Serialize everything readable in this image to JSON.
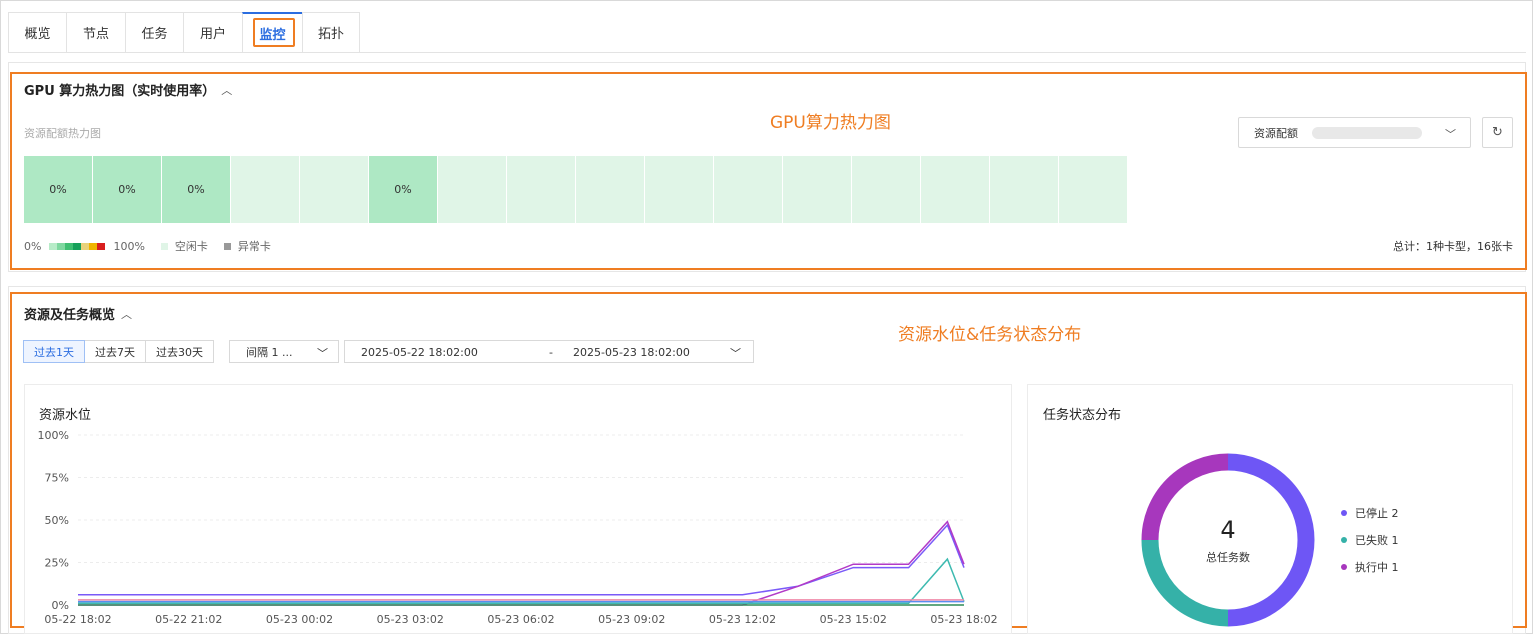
{
  "tabs": [
    {
      "label": "概览"
    },
    {
      "label": "节点"
    },
    {
      "label": "任务"
    },
    {
      "label": "用户"
    },
    {
      "label": "监控",
      "active": true
    },
    {
      "label": "拓扑"
    }
  ],
  "gpu_panel": {
    "title": "GPU 算力热力图（实时使用率）",
    "annotation": "GPU算力热力图",
    "subtitle": "资源配额热力图",
    "select_label": "资源配额",
    "cells": [
      {
        "state": "used",
        "label": "0%"
      },
      {
        "state": "used",
        "label": "0%"
      },
      {
        "state": "used",
        "label": "0%"
      },
      {
        "state": "idle",
        "label": ""
      },
      {
        "state": "idle",
        "label": ""
      },
      {
        "state": "used",
        "label": "0%"
      },
      {
        "state": "idle",
        "label": ""
      },
      {
        "state": "idle",
        "label": ""
      },
      {
        "state": "idle",
        "label": ""
      },
      {
        "state": "idle",
        "label": ""
      },
      {
        "state": "idle",
        "label": ""
      },
      {
        "state": "idle",
        "label": ""
      },
      {
        "state": "idle",
        "label": ""
      },
      {
        "state": "idle",
        "label": ""
      },
      {
        "state": "idle",
        "label": ""
      },
      {
        "state": "idle",
        "label": ""
      }
    ],
    "legend": {
      "min": "0%",
      "max": "100%",
      "idle": "空闲卡",
      "abnormal": "异常卡",
      "gradient_colors": [
        "#b7ecc8",
        "#7fd8a0",
        "#3fbf72",
        "#16a05a",
        "#e9d27a",
        "#f0b400",
        "#d91e1e"
      ],
      "idle_color": "#e0f5e7",
      "abnormal_color": "#999999"
    },
    "total": "总计：1种卡型，16张卡"
  },
  "overview_panel": {
    "title": "资源及任务概览",
    "annotation": "资源水位&任务状态分布",
    "range_buttons": [
      {
        "label": "过去1天",
        "active": true
      },
      {
        "label": "过去7天"
      },
      {
        "label": "过去30天"
      }
    ],
    "interval": "间隔 1 ...",
    "date_start": "2025-05-22 18:02:00",
    "date_sep": "-",
    "date_end": "2025-05-23 18:02:00"
  },
  "water_title": "资源水位",
  "task_title": "任务状态分布",
  "chart_data": [
    {
      "type": "line",
      "title": "资源水位",
      "ylim": [
        0,
        100
      ],
      "y_ticks": [
        "100%",
        "75%",
        "50%",
        "25%",
        "0%"
      ],
      "x_labels": [
        "05-22 18:02",
        "05-22 21:02",
        "05-23 00:02",
        "05-23 03:02",
        "05-23 06:02",
        "05-23 09:02",
        "05-23 12:02",
        "05-23 15:02",
        "05-23 18:02"
      ],
      "x": [
        0,
        1,
        2,
        3,
        4,
        5,
        6,
        6.5,
        7,
        7.5,
        7.85,
        8
      ],
      "series": [
        {
          "color": "#7a5af8",
          "values": [
            6,
            6,
            6,
            6,
            6,
            6,
            6,
            11,
            22,
            22,
            47,
            22
          ]
        },
        {
          "color": "#b23ac7",
          "values": [
            0,
            0,
            0,
            0,
            0,
            0,
            0,
            11,
            24,
            24,
            49,
            24
          ]
        },
        {
          "color": "#3dbab0",
          "values": [
            1,
            1,
            1,
            1,
            1,
            1,
            1,
            1,
            1,
            1,
            27,
            2
          ]
        },
        {
          "color": "#f08aa8",
          "values": [
            3,
            3,
            3,
            3,
            3,
            3,
            3,
            3,
            3,
            3,
            3,
            3
          ]
        },
        {
          "color": "#5b8def",
          "values": [
            2,
            2,
            2,
            2,
            2,
            2,
            2,
            2,
            2,
            2,
            2,
            2
          ]
        },
        {
          "color": "#2e8b57",
          "values": [
            0,
            0,
            0,
            0,
            0,
            0,
            0,
            0,
            0,
            0,
            0,
            0
          ]
        }
      ],
      "grid": true
    },
    {
      "type": "pie",
      "title": "任务状态分布",
      "center_value": "4",
      "center_label": "总任务数",
      "slices": [
        {
          "name": "已停止",
          "value": 2,
          "color": "#6e56f5"
        },
        {
          "name": "已失败",
          "value": 1,
          "color": "#35b1a8"
        },
        {
          "name": "执行中",
          "value": 1,
          "color": "#a737bd"
        }
      ],
      "legend_labels": [
        "已停止 2",
        "已失败 1",
        "执行中 1"
      ]
    }
  ]
}
